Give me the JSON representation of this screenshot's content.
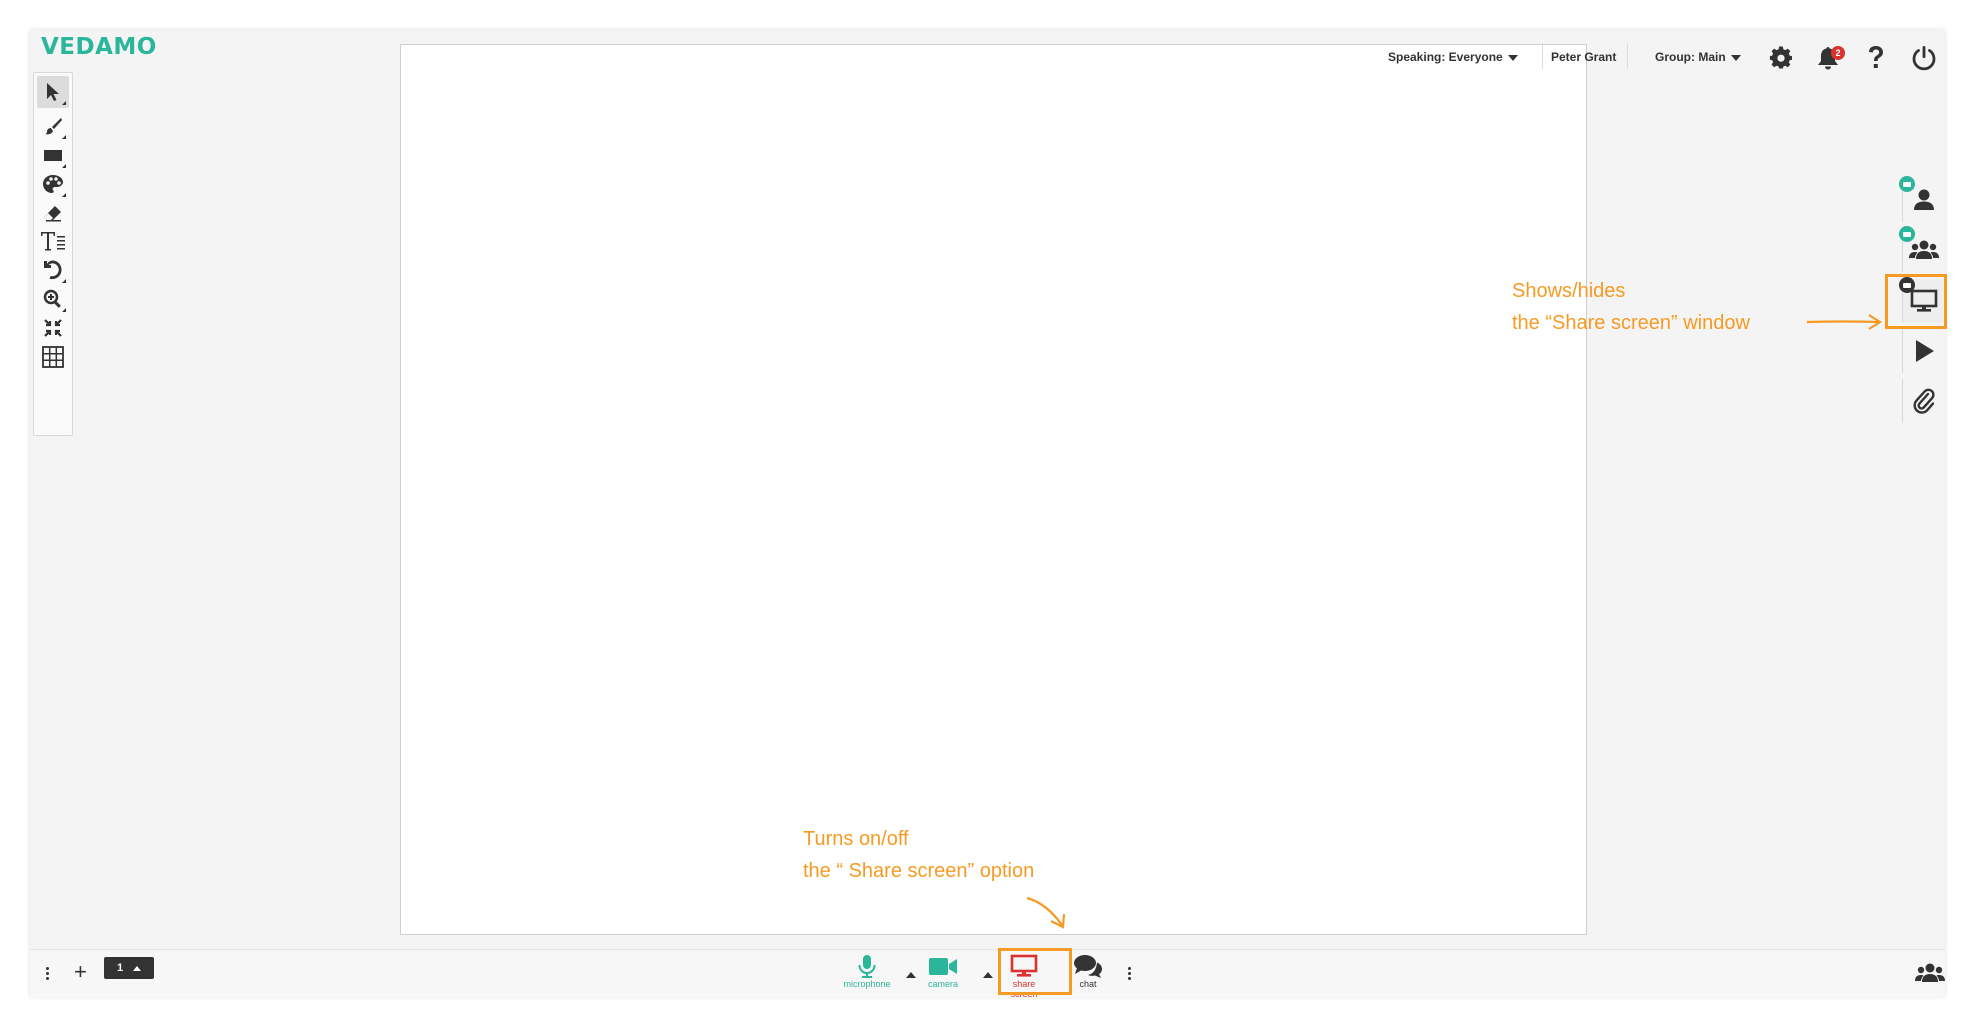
{
  "app": {
    "logo": "VEDAMO"
  },
  "topbar": {
    "speaking": "Speaking: Everyone",
    "user": "Peter Grant",
    "group": "Group: Main",
    "notification_count": "2"
  },
  "tools": [
    {
      "icon": "pointer-icon",
      "name": "select-tool"
    },
    {
      "icon": "brush-icon",
      "name": "pen-tool"
    },
    {
      "icon": "rectangle-icon",
      "name": "shape-tool"
    },
    {
      "icon": "palette-icon",
      "name": "color-tool"
    },
    {
      "icon": "eraser-icon",
      "name": "eraser-tool"
    },
    {
      "icon": "text-icon",
      "name": "text-tool"
    },
    {
      "icon": "undo-icon",
      "name": "undo-tool"
    },
    {
      "icon": "zoom-icon",
      "name": "zoom-tool"
    },
    {
      "icon": "compress-icon",
      "name": "fit-tool"
    },
    {
      "icon": "grid-icon",
      "name": "grid-tool"
    }
  ],
  "bottombar": {
    "page_number": "1",
    "microphone_label": "microphone",
    "camera_label": "camera",
    "share_screen_label": "share screen",
    "chat_label": "chat"
  },
  "colors": {
    "brand": "#2bb59a",
    "annotation": "#f59b23",
    "share_active": "#d9322f",
    "icon": "#333333"
  },
  "annotations": {
    "right_line1": "Shows/hides",
    "right_line2": "the “Share screen” window",
    "bottom_line1": "Turns on/off",
    "bottom_line2": "the “ Share screen” option"
  }
}
